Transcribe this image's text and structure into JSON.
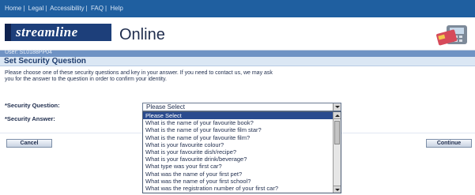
{
  "topnav": {
    "links": [
      "Home",
      "Legal",
      "Accessibility",
      "FAQ",
      "Help"
    ]
  },
  "brand": {
    "logo": "streamline",
    "product": "Online"
  },
  "user": {
    "label": "User: SL0188PP04"
  },
  "page": {
    "title": "Set Security Question",
    "instructions": "Please choose one of these security questions and key in your answer. If you need to contact us, we may ask you for the answer to the question in order to confirm your identity."
  },
  "form": {
    "question_label": "*Security Question:",
    "answer_label": "*Security Answer:",
    "select_value": "Please Select",
    "options": [
      "Please Select",
      "What is the name of your favourite book?",
      "What is the name of your favourite film star?",
      "What is the name of your favourite film?",
      "What is your favourite colour?",
      "What is your favourite dish/recipe?",
      "What is your favourite drink/beverage?",
      "What type was your first car?",
      "What was the name of your first pet?",
      "What was the name of your first school?",
      "What was the registration number of your first car?"
    ],
    "selected_index": 0
  },
  "buttons": {
    "cancel": "Cancel",
    "continue": "Continue"
  },
  "colors": {
    "nav_blue": "#1f5fa0",
    "logo_navy": "#1d3f7a",
    "heading_bg": "#dbe7f4",
    "selected_option": "#2a4b8f"
  }
}
